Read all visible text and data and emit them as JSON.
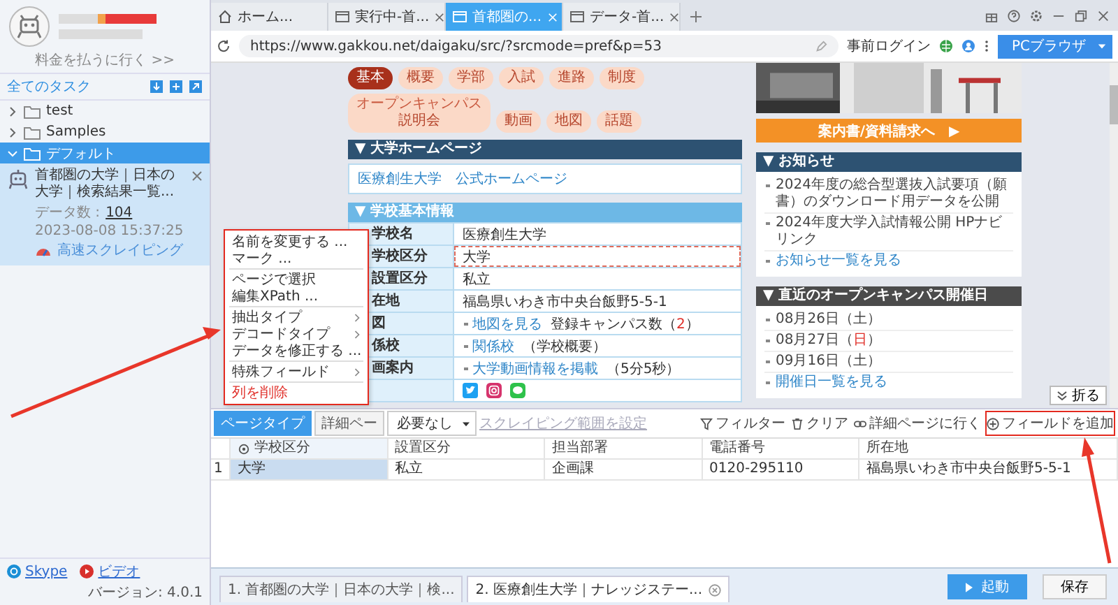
{
  "sidebar": {
    "account_link": "料金を払うに行く >>",
    "all_tasks": "全てのタスク",
    "folders": [
      {
        "name": "test",
        "expanded": false,
        "selected": false
      },
      {
        "name": "Samples",
        "expanded": false,
        "selected": false
      },
      {
        "name": "デフォルト",
        "expanded": true,
        "selected": true,
        "children": [
          {
            "title": "首都圏の大学｜日本の大学｜検索結果一覧...",
            "data_count_label": "データ数 :",
            "data_count": "104",
            "time": "2023-08-08 15:37:25",
            "mode": "高速スクレイピング"
          }
        ]
      }
    ],
    "footer": {
      "skype": "Skype",
      "video": "ビデオ",
      "version": "バージョン: 4.0.1"
    }
  },
  "browser": {
    "tabs": [
      {
        "label": "ホーム...",
        "kind": "home",
        "selected": false,
        "closable": false
      },
      {
        "label": "実行中-首...",
        "kind": "page",
        "selected": false,
        "closable": true
      },
      {
        "label": "首都圏の...",
        "kind": "page",
        "selected": true,
        "closable": true
      },
      {
        "label": "データ-首...",
        "kind": "page",
        "selected": false,
        "closable": true
      }
    ],
    "url": "https://www.gakkou.net/daigaku/src/?srcmode=pref&p=53",
    "login": "事前ログイン",
    "mode_button": "PCブラウザ"
  },
  "page": {
    "nav": [
      {
        "label": "基本",
        "selected": true
      },
      {
        "label": "概要",
        "selected": false
      },
      {
        "label": "学部",
        "selected": false
      },
      {
        "label": "入試",
        "selected": false
      },
      {
        "label": "進路",
        "selected": false
      },
      {
        "label": "制度",
        "selected": false
      },
      {
        "label": "説明会",
        "ruby": "オープンキャンパス",
        "selected": false
      },
      {
        "label": "動画",
        "selected": false
      },
      {
        "label": "地図",
        "selected": false
      },
      {
        "label": "話題",
        "selected": false
      }
    ],
    "homepage": {
      "title": "▼ 大学ホームページ",
      "link": "医療創生大学　公式ホームページ"
    },
    "basic_info": {
      "title": "▼ 学校基本情報",
      "rows": [
        {
          "label": "学校名",
          "kind": "text",
          "highlighted": false,
          "text": [
            {
              "text": "医療創生大学",
              "accent": false
            }
          ]
        },
        {
          "label": "学校区分",
          "kind": "text",
          "highlighted": true,
          "text": [
            {
              "text": "大学",
              "accent": false
            }
          ]
        },
        {
          "label": "設置区分",
          "kind": "text",
          "highlighted": false,
          "text": [
            {
              "text": "私立",
              "accent": false
            }
          ]
        },
        {
          "label": "在地",
          "kind": "text",
          "highlighted": false,
          "text": [
            {
              "text": "福島県いわき市中央台飯野5-5-1",
              "accent": false
            }
          ]
        },
        {
          "label": "図",
          "kind": "text",
          "highlighted": false,
          "link": "地図を見る",
          "text": [
            {
              "text": "登録キャンパス数（",
              "accent": false
            },
            {
              "text": "2",
              "accent": true
            },
            {
              "text": "）",
              "accent": false
            }
          ]
        },
        {
          "label": "係校",
          "kind": "text",
          "highlighted": false,
          "link": "関係校",
          "text": [
            {
              "text": "（学校概要）",
              "accent": false
            }
          ]
        },
        {
          "label": "画案内",
          "kind": "text",
          "highlighted": false,
          "link": "大学動画情報を掲載",
          "text": [
            {
              "text": "（5分5秒）",
              "accent": false
            }
          ]
        },
        {
          "kind": "social",
          "highlighted": false
        }
      ]
    },
    "request_button": "案内書/資料請求へ　▶",
    "notices": {
      "title": "▼ お知らせ",
      "items": [
        "2024年度の総合型選抜入試要項（願書）のダウンロード用データを公開",
        "2024年度大学入試情報公開 HPナビリンク"
      ],
      "more": "お知らせ一覧を見る"
    },
    "open_campus": {
      "title": "▼ 直近のオープンキャンパス開催日",
      "dates": [
        [
          {
            "text": "08月26日（",
            "accent": false
          },
          {
            "text": "土",
            "accent": false
          },
          {
            "text": "）",
            "accent": false
          }
        ],
        [
          {
            "text": "08月27日（",
            "accent": false
          },
          {
            "text": "日",
            "accent": true
          },
          {
            "text": "）",
            "accent": false
          }
        ],
        [
          {
            "text": "09月16日（",
            "accent": false
          },
          {
            "text": "土",
            "accent": false
          },
          {
            "text": "）",
            "accent": false
          }
        ]
      ],
      "more": "開催日一覧を見る"
    }
  },
  "context_menu": [
    {
      "label": "名前を変更する ...",
      "kind": "action"
    },
    {
      "label": "マーク ...",
      "kind": "action"
    },
    {
      "kind": "divider"
    },
    {
      "label": "ページで選択",
      "kind": "action"
    },
    {
      "label": "編集XPath ...",
      "kind": "action"
    },
    {
      "kind": "divider"
    },
    {
      "label": "抽出タイプ",
      "kind": "submenu"
    },
    {
      "label": "デコードタイプ",
      "kind": "submenu"
    },
    {
      "label": "データを修正する ...",
      "kind": "action"
    },
    {
      "kind": "divider"
    },
    {
      "label": "特殊フィールド",
      "kind": "submenu"
    },
    {
      "kind": "divider"
    },
    {
      "label": "列を削除",
      "kind": "danger"
    }
  ],
  "panel": {
    "collapse": "折る",
    "page_tabs": [
      {
        "label": "ページタイプ",
        "selected": true
      },
      {
        "label": "詳細ペー",
        "selected": false
      }
    ],
    "select": "必要なし",
    "range_link": {
      "label": "スクレイピング範囲を設定",
      "disabled": true
    },
    "tools": [
      {
        "label": "フィルター",
        "kind": "filter",
        "highlighted": false
      },
      {
        "label": "クリア",
        "kind": "clear",
        "highlighted": false
      },
      {
        "label": "詳細ページに行く",
        "kind": "link",
        "highlighted": false
      },
      {
        "label": "フィールドを追加",
        "kind": "add",
        "highlighted": true
      }
    ],
    "columns": [
      {
        "label": "学校区分",
        "selected": true
      },
      {
        "label": "設置区分",
        "selected": false
      },
      {
        "label": "担当部署",
        "selected": false
      },
      {
        "label": "電話番号",
        "selected": false
      },
      {
        "label": "所在地",
        "selected": false
      }
    ],
    "rows": [
      {
        "index": "1",
        "cells": [
          "大学",
          "私立",
          "企画課",
          "0120-295110",
          "福島県いわき市中央台飯野5-5-1"
        ]
      }
    ]
  },
  "run_tabs": [
    {
      "label": "1. 首都圏の大学｜日本の大学｜検...",
      "selected": false
    },
    {
      "label": "2. 医療創生大学｜ナレッジステー...",
      "selected": true
    }
  ],
  "actions": {
    "start": "起動",
    "save": "保存"
  }
}
